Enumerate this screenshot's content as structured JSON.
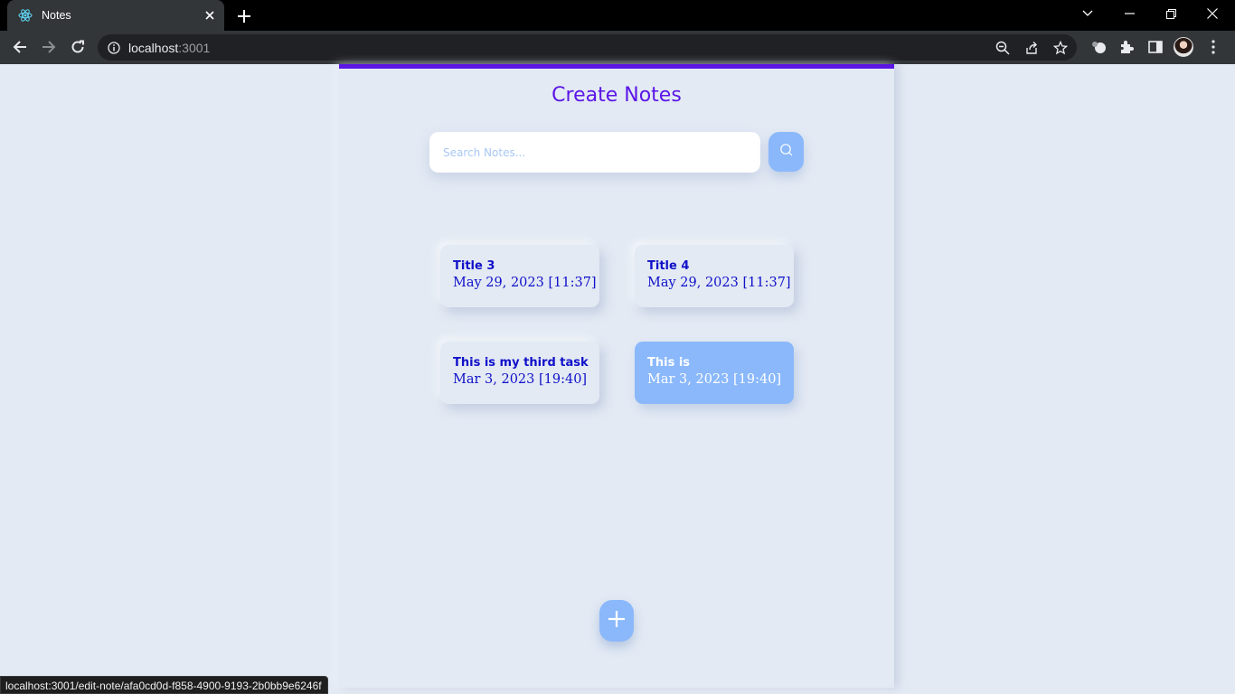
{
  "browser": {
    "tab_title": "Notes",
    "url_host": "localhost",
    "url_port": ":3001",
    "status_url": "localhost:3001/edit-note/afa0cd0d-f858-4900-9193-2b0bb9e6246f",
    "icons": [
      "react-favicon-icon",
      "close-icon",
      "plus-icon",
      "chevron-down-icon",
      "minimize-icon",
      "restore-icon",
      "close-window-icon",
      "back-arrow-icon",
      "forward-arrow-icon",
      "reload-icon",
      "info-icon",
      "zoom-icon",
      "share-icon",
      "star-icon",
      "extension-icon",
      "puzzle-icon",
      "sidepanel-icon",
      "kebab-menu-icon"
    ]
  },
  "app": {
    "title": "Create Notes",
    "search": {
      "placeholder": "Search Notes..."
    },
    "notes": [
      {
        "title": "Title 3",
        "date": "May 29, 2023 [11:37]",
        "active": false
      },
      {
        "title": "Title 4",
        "date": "May 29, 2023 [11:37]",
        "active": false
      },
      {
        "title": "This is my third task",
        "date": "Mar 3, 2023 [19:40]",
        "active": false
      },
      {
        "title": "This is",
        "date": "Mar 3, 2023 [19:40]",
        "active": true
      }
    ]
  },
  "colors": {
    "accent": "#5b16e6",
    "button": "#8ab8fb",
    "note_text": "#1010c8",
    "background": "#e3eaf4"
  }
}
